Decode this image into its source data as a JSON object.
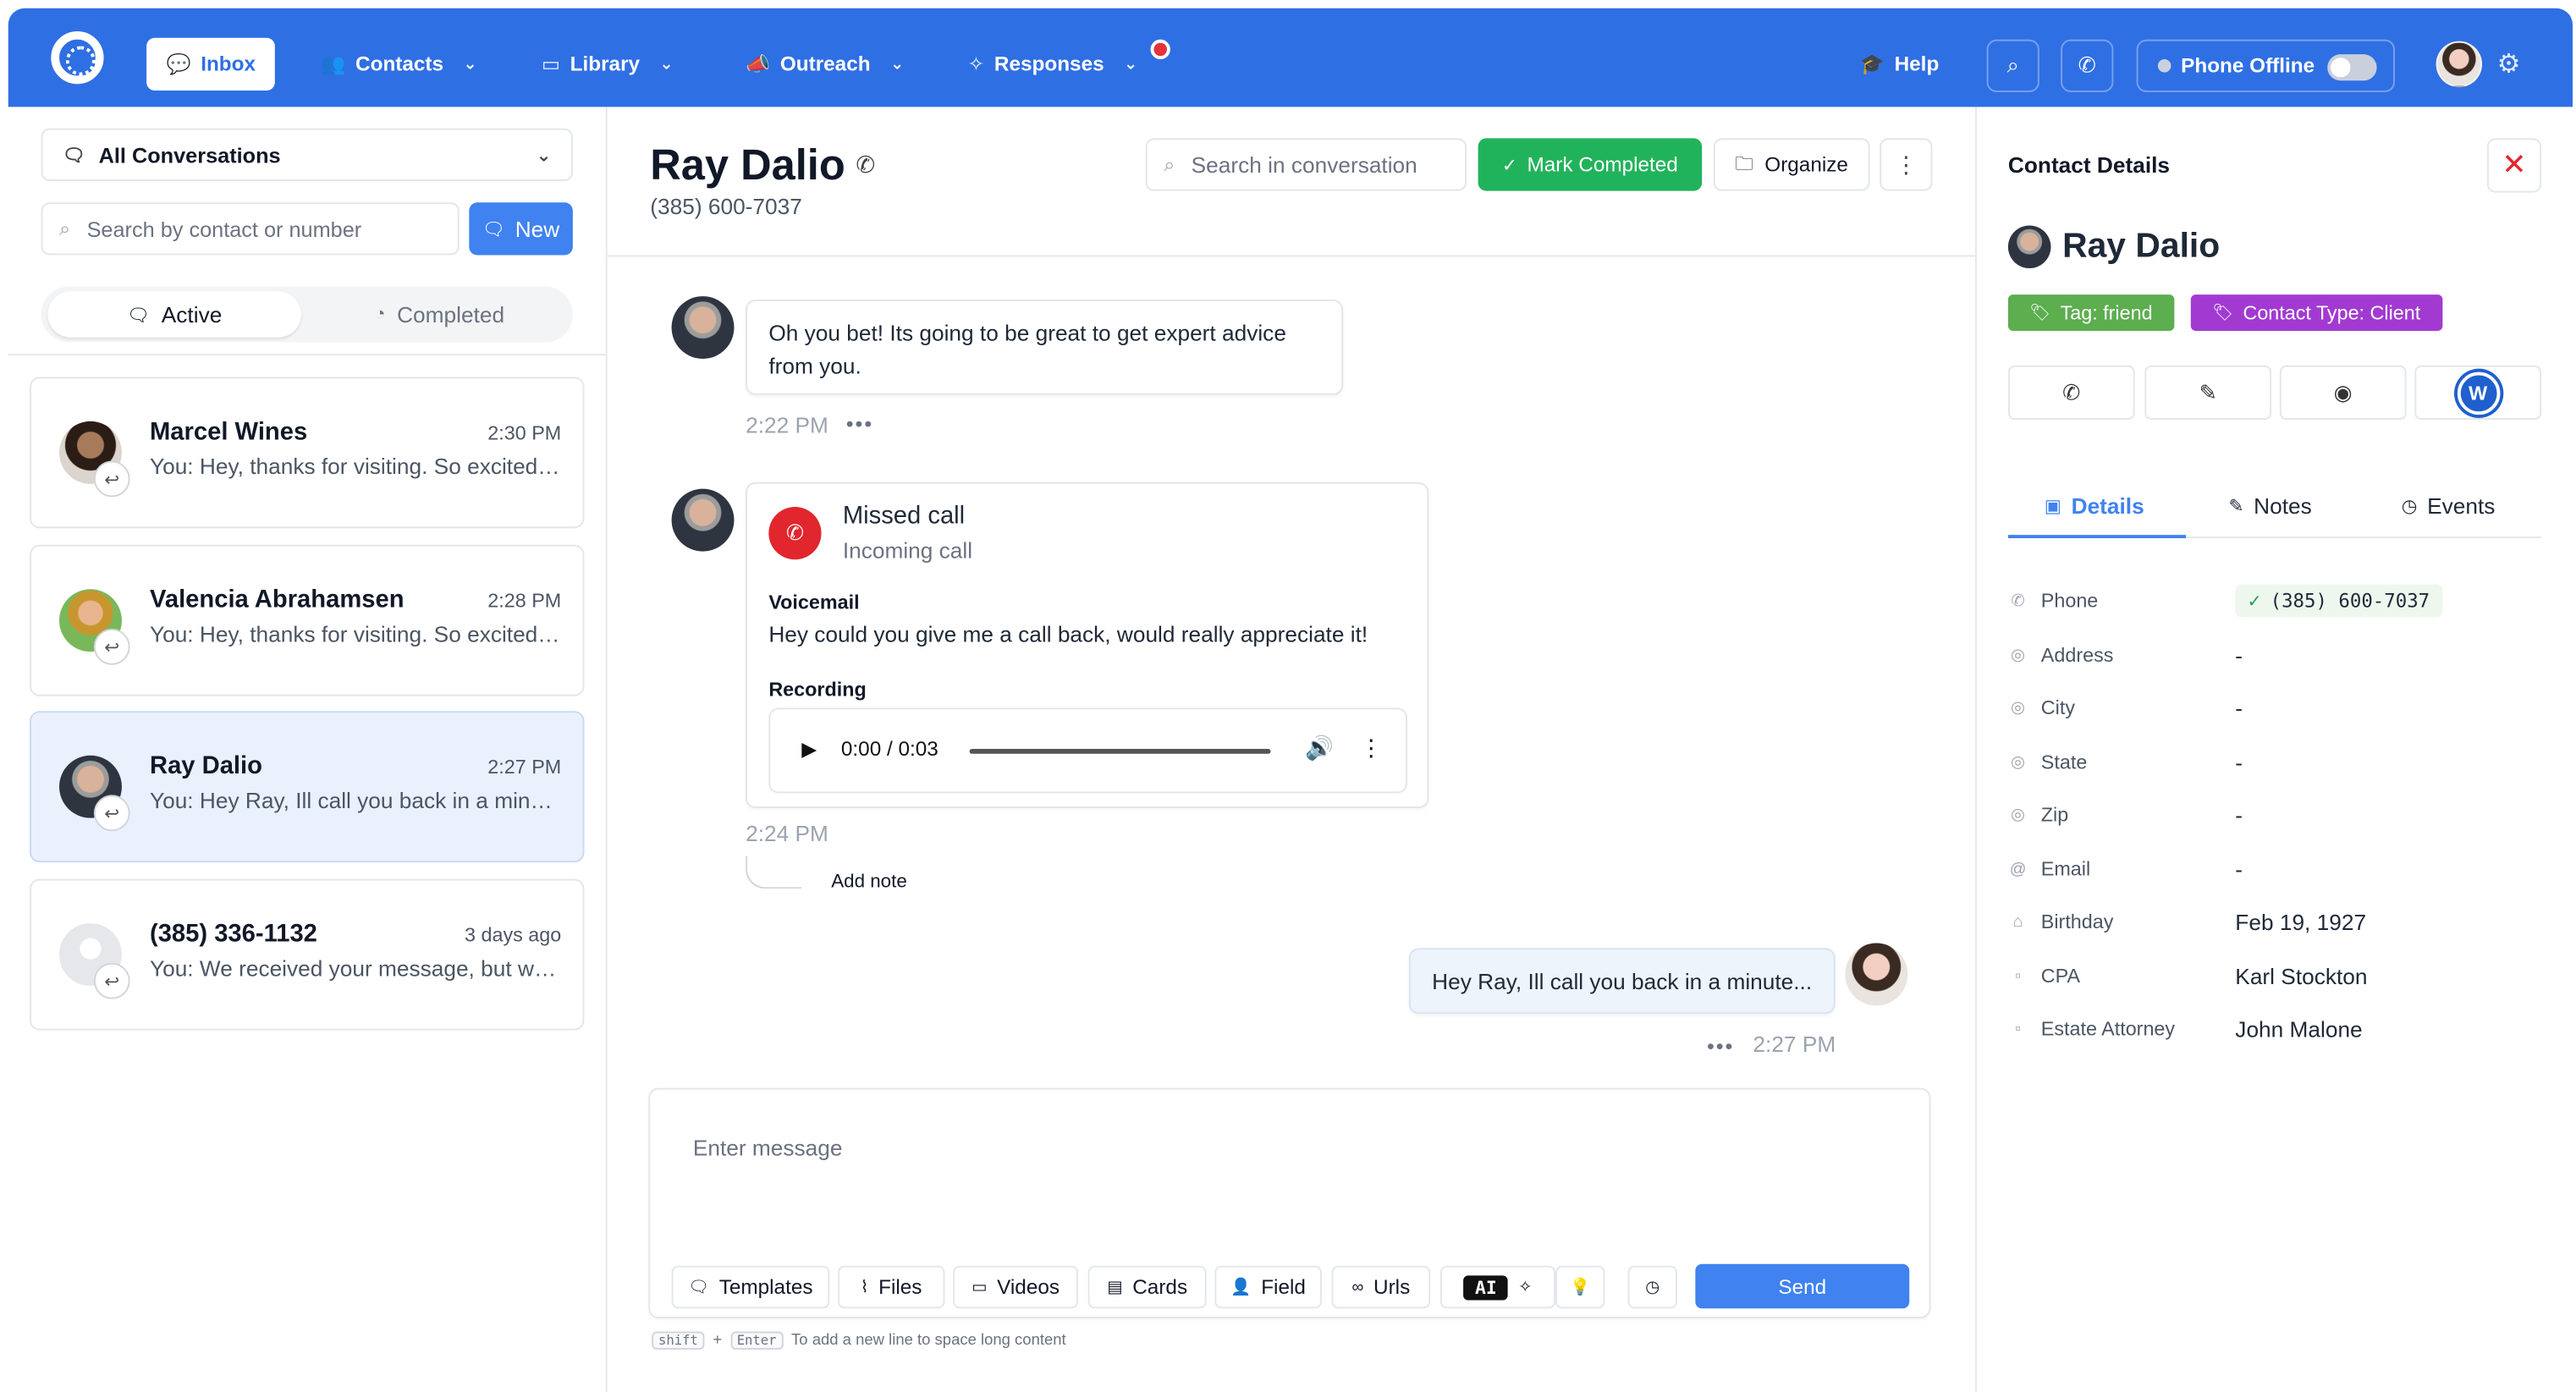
{
  "nav": {
    "items": [
      {
        "label": "Inbox",
        "icon": "chat-icon"
      },
      {
        "label": "Contacts",
        "icon": "users-icon"
      },
      {
        "label": "Library",
        "icon": "library-icon"
      },
      {
        "label": "Outreach",
        "icon": "megaphone-icon"
      },
      {
        "label": "Responses",
        "icon": "sparkle-icon"
      }
    ],
    "help_label": "Help",
    "phone_status": "Phone Offline"
  },
  "left": {
    "filter_label": "All Conversations",
    "search_placeholder": "Search by contact or number",
    "new_label": "New",
    "tab_active": "Active",
    "tab_completed": "Completed",
    "conversations": [
      {
        "name": "Marcel Wines",
        "time": "2:30 PM",
        "preview": "You: Hey, thanks for visiting. So excited to work with you!"
      },
      {
        "name": "Valencia Abrahamsen",
        "time": "2:28 PM",
        "preview": "You: Hey, thanks for visiting. So excited to work with you!"
      },
      {
        "name": "Ray Dalio",
        "time": "2:27 PM",
        "preview": "You: Hey Ray, Ill call you back in a minute..."
      },
      {
        "name": "(385) 336-1132",
        "time": "3 days ago",
        "preview": "You: We received your message, but we are away"
      }
    ]
  },
  "conversation": {
    "contact_name": "Ray Dalio",
    "contact_phone": "(385) 600-7037",
    "search_placeholder": "Search in conversation",
    "mark_completed_label": "Mark Completed",
    "organize_label": "Organize",
    "messages": {
      "m1_text": "Oh you bet! Its going to be great to get expert advice from you.",
      "m1_time": "2:22 PM",
      "call_title": "Missed call",
      "call_sub": "Incoming call",
      "voicemail_label": "Voicemail",
      "voicemail_text": "Hey could you give me a call back, would really appreciate it!",
      "recording_label": "Recording",
      "audio_time": "0:00 / 0:03",
      "m2_time": "2:24 PM",
      "add_note_label": "Add note",
      "m3_text": "Hey Ray, Ill call you back in a minute...",
      "m3_time": "2:27 PM"
    },
    "composer": {
      "placeholder": "Enter message",
      "templates_label": "Templates",
      "files_label": "Files",
      "videos_label": "Videos",
      "cards_label": "Cards",
      "field_label": "Field",
      "urls_label": "Urls",
      "ai_label": "AI",
      "send_label": "Send",
      "hint_shift": "shift",
      "hint_plus": "+",
      "hint_enter": "Enter",
      "hint_text": "To add a new line to space long content"
    }
  },
  "details": {
    "title": "Contact Details",
    "name": "Ray Dalio",
    "tag1": "Tag: friend",
    "tag2": "Contact Type: Client",
    "tag1_color": "#5cae4f",
    "tag2_color": "#a23ad1",
    "tab_details": "Details",
    "tab_notes": "Notes",
    "tab_events": "Events",
    "fields": [
      {
        "label": "Phone",
        "value": "(385) 600-7037",
        "icon": "phone-icon"
      },
      {
        "label": "Address",
        "value": "-",
        "icon": "pin-icon"
      },
      {
        "label": "City",
        "value": "-",
        "icon": "pin-icon"
      },
      {
        "label": "State",
        "value": "-",
        "icon": "pin-icon"
      },
      {
        "label": "Zip",
        "value": "-",
        "icon": "pin-icon"
      },
      {
        "label": "Email",
        "value": "-",
        "icon": "at-icon"
      },
      {
        "label": "Birthday",
        "value": "Feb 19, 1927",
        "icon": "cake-icon"
      },
      {
        "label": "CPA",
        "value": "Karl Stockton",
        "icon": "box-icon"
      },
      {
        "label": "Estate Attorney",
        "value": "John Malone",
        "icon": "box-icon"
      }
    ]
  },
  "colors": {
    "brand": "#2f6fe4",
    "accent": "#3f82f0",
    "success": "#21b35b",
    "danger": "#e1262d"
  }
}
